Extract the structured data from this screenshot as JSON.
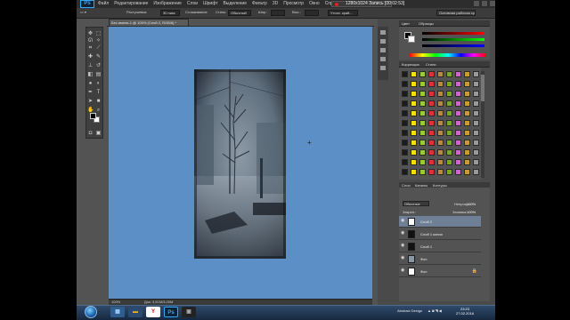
{
  "app": {
    "logo": "Ps",
    "menu": [
      "Файл",
      "Редактирование",
      "Изображение",
      "Слои",
      "Шрифт",
      "Выделение",
      "Фильтр",
      "3D",
      "Просмотр",
      "Окно",
      "Справка"
    ],
    "recording": {
      "label": "Запись [00:02:53]",
      "resolution": "1280x1024"
    },
    "workspace": "Основная рабочая среда"
  },
  "options": {
    "mode_label": "Растушевка:",
    "feather_value": "30 пикс",
    "antialias_label": "Сглаживание",
    "style_label": "Стиль:",
    "style_value": "Обычный",
    "width_label": "Шир.:",
    "height_label": "Выс.:",
    "refine_label": "Уточн. край..."
  },
  "document": {
    "tab_title": "Без имени-1 @ 100% (Слой 2, RGB/8) *",
    "zoom": "100%",
    "doc_size": "Док: 3,51M/3,00M"
  },
  "panels": {
    "color_tab": "Цвет",
    "swatches_tab": "Образцы",
    "styles_tab_1": "Коррекция",
    "styles_tab_2": "Стили",
    "layers_tab": "Слои",
    "channels_tab": "Каналы",
    "paths_tab": "Контуры",
    "blend_mode": "Обычные",
    "opacity_label": "Непрозр.:",
    "opacity_value": "100%",
    "lock_label": "Закреп.:",
    "fill_label": "Заливка:",
    "fill_value": "100%"
  },
  "layers": [
    {
      "name": "Слой 2",
      "selected": true,
      "thumb": "#ffffff"
    },
    {
      "name": "Слой 1 копия",
      "selected": false,
      "thumb": "#111111"
    },
    {
      "name": "Слой 1",
      "selected": false,
      "thumb": "#111111"
    },
    {
      "name": "Фон",
      "selected": false,
      "thumb": "#8a97a4"
    },
    {
      "name": "Фон",
      "selected": false,
      "thumb": "#ffffff",
      "locked": true
    }
  ],
  "taskbar": {
    "tray_label": "Abstract Design",
    "time": "23:23",
    "date": "27.02.2016"
  },
  "colors": {
    "canvas_bg": "#5d8fc7",
    "ui_dark": "#535353",
    "accent": "#31a8ff"
  }
}
